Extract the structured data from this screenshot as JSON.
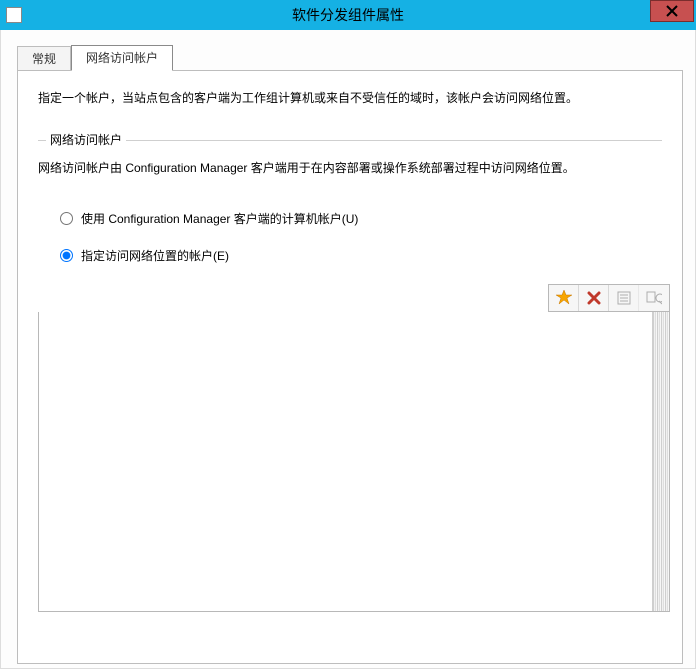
{
  "window": {
    "title": "软件分发组件属性"
  },
  "tabs": {
    "general": "常规",
    "network_access_account": "网络访问帐户"
  },
  "description": "指定一个帐户，当站点包含的客户端为工作组计算机或来自不受信任的域时，该帐户会访问网络位置。",
  "group": {
    "legend": "网络访问帐户",
    "explain": "网络访问帐户由 Configuration Manager 客户端用于在内容部署或操作系统部署过程中访问网络位置。"
  },
  "options": {
    "use_computer_account": "使用 Configuration Manager 客户端的计算机帐户(U)",
    "specify_account": "指定访问网络位置的帐户(E)",
    "selected": "specify_account"
  },
  "toolbar": {
    "new_icon": "new-starburst-icon",
    "delete_icon": "delete-x-icon",
    "properties_icon": "properties-icon",
    "verify_icon": "verify-icon"
  }
}
